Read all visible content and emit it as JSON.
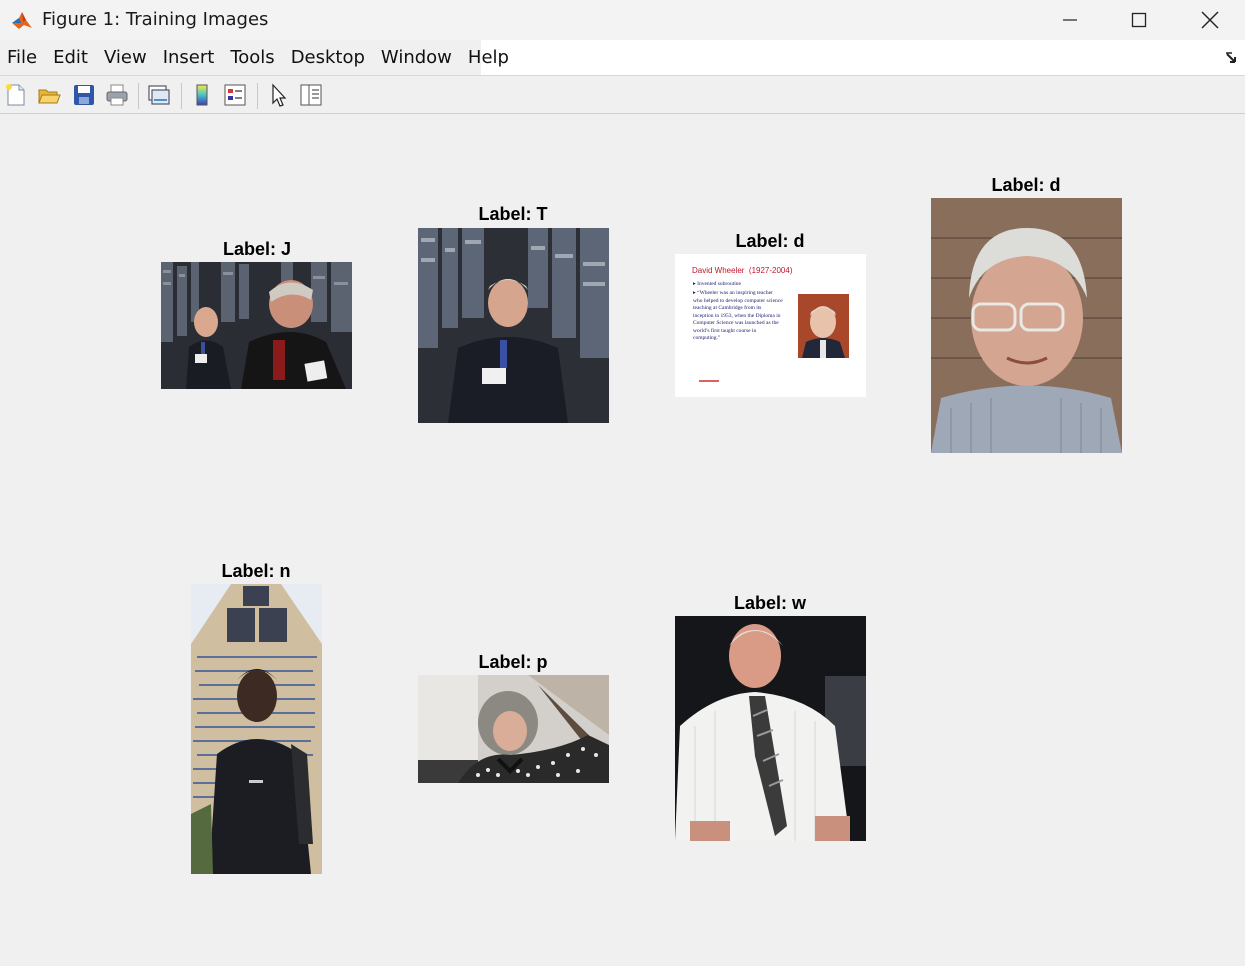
{
  "window": {
    "title": "Figure 1: Training Images"
  },
  "menu": {
    "items": [
      "File",
      "Edit",
      "View",
      "Insert",
      "Tools",
      "Desktop",
      "Window",
      "Help"
    ]
  },
  "toolbar": {
    "buttons": [
      "new-figure-icon",
      "open-file-icon",
      "save-icon",
      "print-icon",
      "link-plot-icon",
      "colorbar-icon",
      "legend-icon",
      "pointer-icon",
      "property-inspector-icon"
    ]
  },
  "images": [
    {
      "title": "Label: J",
      "content": "two elderly men seated in front of computer equipment"
    },
    {
      "title": "Label: T",
      "content": "elderly man seated in front of computer equipment"
    },
    {
      "title": "Label: d",
      "content": "slide with text and portrait"
    },
    {
      "title": "Label: d",
      "content": "elderly man with glasses portrait"
    },
    {
      "title": "Label: n",
      "content": "young man in front of memorial wall"
    },
    {
      "title": "Label: p",
      "content": "woman with curly grey hair"
    },
    {
      "title": "Label: w",
      "content": "elderly man in white shirt and tie"
    }
  ],
  "slide": {
    "heading": "David Wheeler  (1927-2004)",
    "bullet1": "Invented subroutine",
    "bullet2": "“Wheeler was an inspiring teacher who helped to develop computer science teaching at Cambridge from its inception in 1953, when the Diploma in Computer Science was launched as the world’s first taught course in computing.”"
  }
}
